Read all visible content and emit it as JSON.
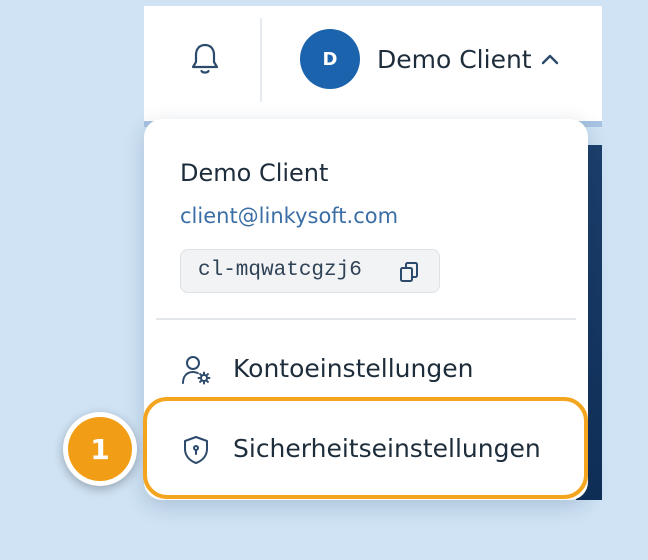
{
  "header": {
    "user_name": "Demo Client",
    "avatar_initial": "D",
    "avatar_color": "#1b64ad"
  },
  "menu": {
    "user_name": "Demo Client",
    "email": "client@linkysoft.com",
    "client_id": "cl-mqwatcgzj6",
    "items": [
      {
        "label": "Kontoeinstellungen",
        "icon": "user-settings-icon"
      },
      {
        "label": "Sicherheitseinstellungen",
        "icon": "shield-icon"
      }
    ]
  },
  "annotation": {
    "step_number": "1",
    "highlight_color": "#f4a51f"
  }
}
